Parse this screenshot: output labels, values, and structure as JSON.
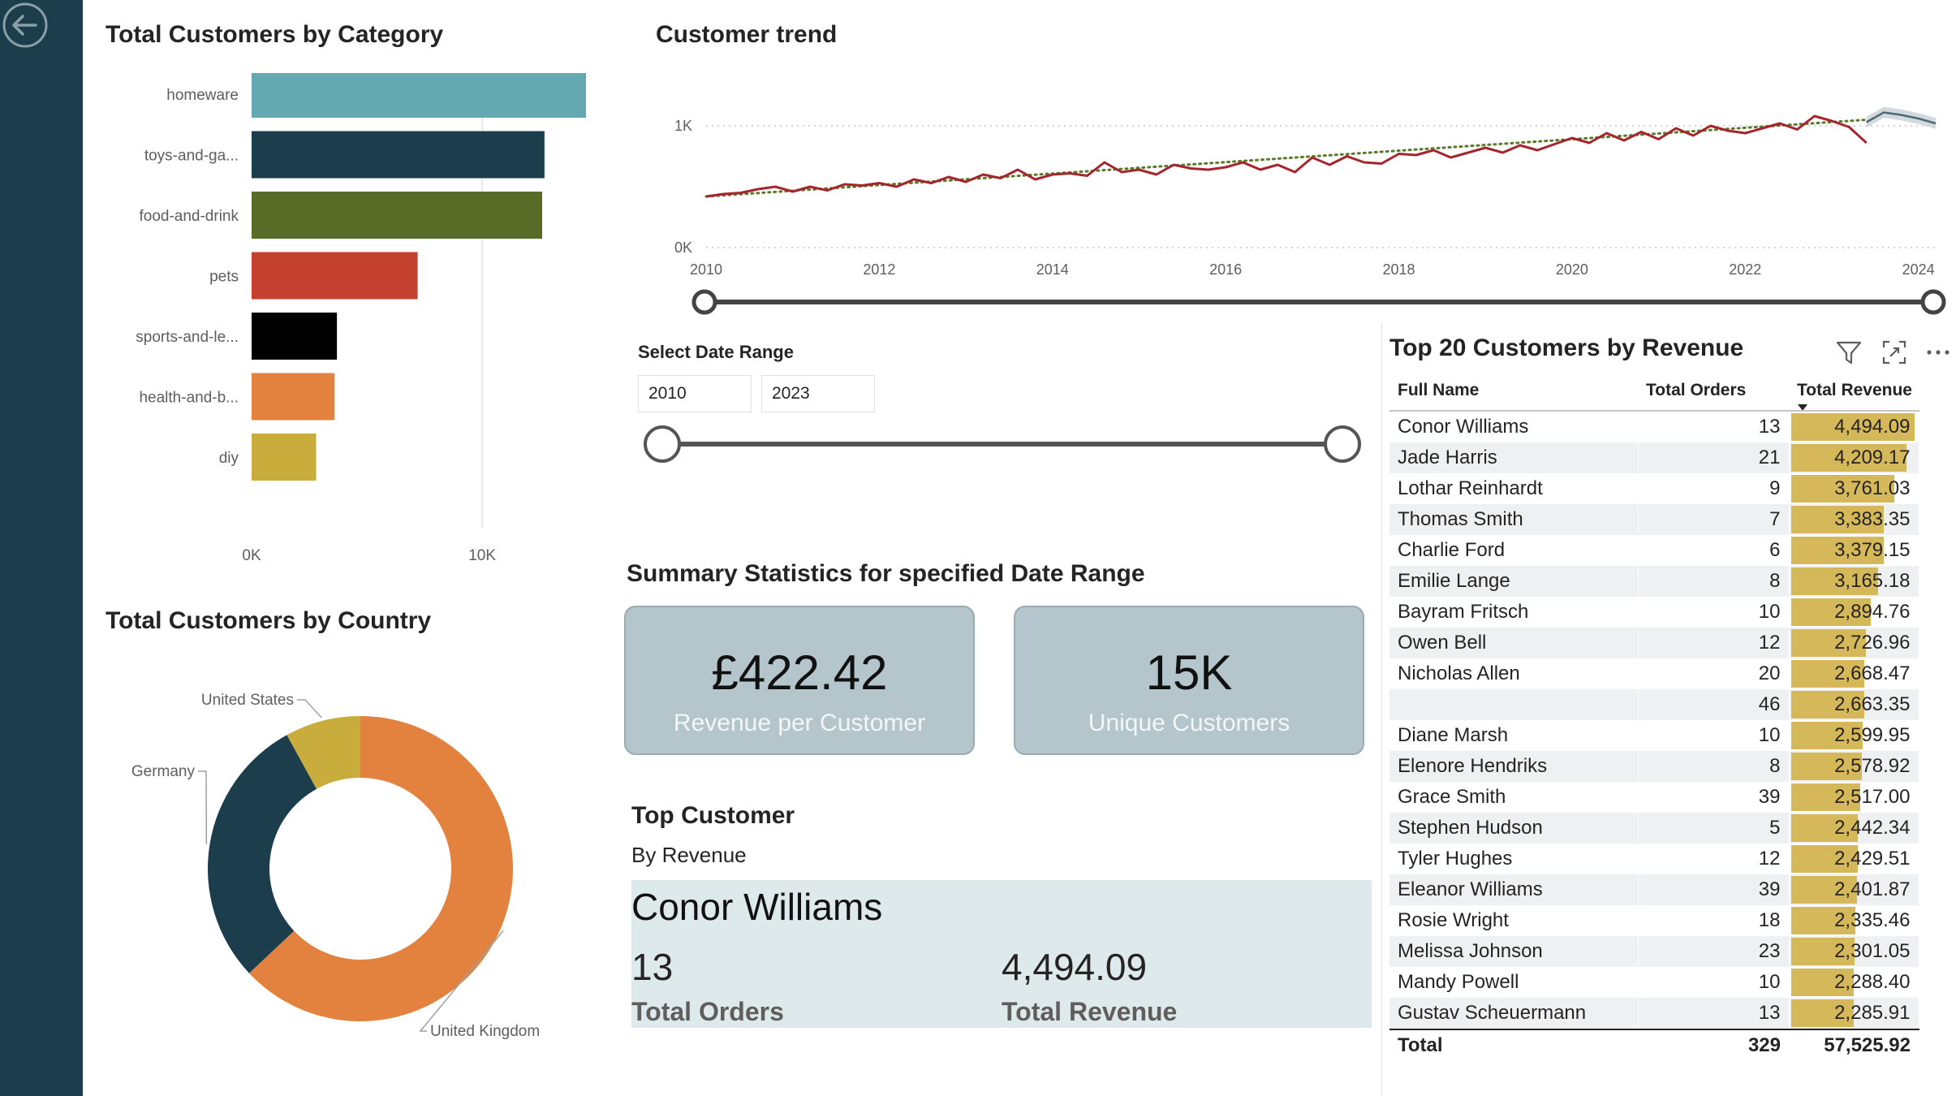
{
  "theme": {
    "sidebar": "#1b3d4c",
    "card_bg": "#b4c6cb",
    "top_box_bg": "#dde9eb",
    "revenue_bar": "#d4b85a",
    "trend_line": "#a4262c",
    "trend_dots": "#5a7a2a"
  },
  "category_visual": {
    "title": "Total Customers by Category"
  },
  "country_visual": {
    "title": "Total Customers by Country"
  },
  "trend_visual": {
    "title": "Customer trend"
  },
  "date_slicer": {
    "title": "Select Date Range",
    "start": "2010",
    "end": "2023"
  },
  "summary": {
    "title": "Summary Statistics for specified Date Range",
    "revenue_value": "£422.42",
    "revenue_label": "Revenue per Customer",
    "unique_value": "15K",
    "unique_label": "Unique Customers"
  },
  "top_customer": {
    "title": "Top Customer",
    "subtitle": "By Revenue",
    "name": "Conor Williams",
    "orders_value": "13",
    "orders_label": "Total Orders",
    "revenue_value": "4,494.09",
    "revenue_label": "Total Revenue"
  },
  "icons": [
    "back-arrow-icon",
    "filter-icon",
    "focus-mode-icon",
    "more-options-icon"
  ],
  "chart_data": [
    {
      "type": "bar",
      "title": "Total Customers by Category",
      "orientation": "horizontal",
      "categories": [
        "homeware",
        "toys-and-ga...",
        "food-and-drink",
        "pets",
        "sports-and-le...",
        "health-and-b...",
        "diy"
      ],
      "values": [
        14500,
        12700,
        12600,
        7200,
        3700,
        3600,
        2800
      ],
      "colors": [
        "#64a9b1",
        "#1b3d4c",
        "#586c27",
        "#c4402f",
        "#000000",
        "#e3823e",
        "#c9ad3c"
      ],
      "x_ticks": [
        "0K",
        "10K"
      ],
      "xlim": [
        0,
        14500
      ],
      "grid": true
    },
    {
      "type": "pie",
      "title": "Total Customers by Country",
      "donut": true,
      "labels": [
        "United Kingdom",
        "Germany",
        "United States"
      ],
      "values": [
        63,
        29,
        8
      ],
      "colors": [
        "#e3823e",
        "#1b3d4c",
        "#c9ad3c"
      ]
    },
    {
      "type": "line",
      "title": "Customer trend",
      "x_ticks": [
        "2010",
        "2012",
        "2014",
        "2016",
        "2018",
        "2020",
        "2022",
        "2024"
      ],
      "y_ticks": [
        "0K",
        "1K"
      ],
      "xlim": [
        2010,
        2024.2
      ],
      "ylim": [
        0,
        1000
      ],
      "grid": true,
      "x": [
        2010.0,
        2010.2,
        2010.4,
        2010.6,
        2010.8,
        2011.0,
        2011.2,
        2011.4,
        2011.6,
        2011.8,
        2012.0,
        2012.2,
        2012.4,
        2012.6,
        2012.8,
        2013.0,
        2013.2,
        2013.4,
        2013.6,
        2013.8,
        2014.0,
        2014.2,
        2014.4,
        2014.6,
        2014.8,
        2015.0,
        2015.2,
        2015.4,
        2015.6,
        2015.8,
        2016.0,
        2016.2,
        2016.4,
        2016.6,
        2016.8,
        2017.0,
        2017.2,
        2017.4,
        2017.6,
        2017.8,
        2018.0,
        2018.2,
        2018.4,
        2018.6,
        2018.8,
        2019.0,
        2019.2,
        2019.4,
        2019.6,
        2019.8,
        2020.0,
        2020.2,
        2020.4,
        2020.6,
        2020.8,
        2021.0,
        2021.2,
        2021.4,
        2021.6,
        2021.8,
        2022.0,
        2022.2,
        2022.4,
        2022.6,
        2022.8,
        2023.0,
        2023.2,
        2023.4
      ],
      "series": [
        {
          "values": [
            420,
            440,
            450,
            480,
            500,
            460,
            500,
            470,
            520,
            510,
            530,
            500,
            560,
            530,
            580,
            540,
            600,
            570,
            640,
            560,
            600,
            610,
            590,
            700,
            620,
            640,
            600,
            680,
            650,
            640,
            660,
            700,
            640,
            680,
            620,
            740,
            680,
            750,
            700,
            690,
            770,
            760,
            800,
            740,
            780,
            820,
            780,
            840,
            800,
            850,
            900,
            860,
            940,
            880,
            950,
            890,
            980,
            920,
            1000,
            960,
            940,
            980,
            1020,
            970,
            1080,
            1040,
            990,
            860
          ]
        }
      ],
      "trend": {
        "start": [
          2010,
          420
        ],
        "end": [
          2023.4,
          1050
        ]
      },
      "forecast": {
        "x": [
          2023.4,
          2023.6,
          2023.8,
          2024.0,
          2024.2
        ],
        "values": [
          1030,
          1110,
          1090,
          1060,
          1020
        ]
      }
    },
    {
      "type": "table",
      "title": "Top 20 Customers by Revenue",
      "columns": [
        "Full Name",
        "Total Orders",
        "Total Revenue"
      ],
      "rows": [
        [
          "Conor Williams",
          "13",
          "4,494.09"
        ],
        [
          "Jade Harris",
          "21",
          "4,209.17"
        ],
        [
          "Lothar Reinhardt",
          "9",
          "3,761.03"
        ],
        [
          "Thomas Smith",
          "7",
          "3,383.35"
        ],
        [
          "Charlie Ford",
          "6",
          "3,379.15"
        ],
        [
          "Emilie Lange",
          "8",
          "3,165.18"
        ],
        [
          "Bayram Fritsch",
          "10",
          "2,894.76"
        ],
        [
          "Owen Bell",
          "12",
          "2,726.96"
        ],
        [
          "Nicholas Allen",
          "20",
          "2,668.47"
        ],
        [
          "",
          "46",
          "2,663.35"
        ],
        [
          "Diane Marsh",
          "10",
          "2,599.95"
        ],
        [
          "Elenore Hendriks",
          "8",
          "2,578.92"
        ],
        [
          "Grace Smith",
          "39",
          "2,517.00"
        ],
        [
          "Stephen Hudson",
          "5",
          "2,442.34"
        ],
        [
          "Tyler Hughes",
          "12",
          "2,429.51"
        ],
        [
          "Eleanor Williams",
          "39",
          "2,401.87"
        ],
        [
          "Rosie Wright",
          "18",
          "2,335.46"
        ],
        [
          "Melissa Johnson",
          "23",
          "2,301.05"
        ],
        [
          "Mandy Powell",
          "10",
          "2,288.40"
        ],
        [
          "Gustav Scheuermann",
          "13",
          "2,285.91"
        ]
      ],
      "total": [
        "Total",
        "329",
        "57,525.92"
      ]
    }
  ]
}
